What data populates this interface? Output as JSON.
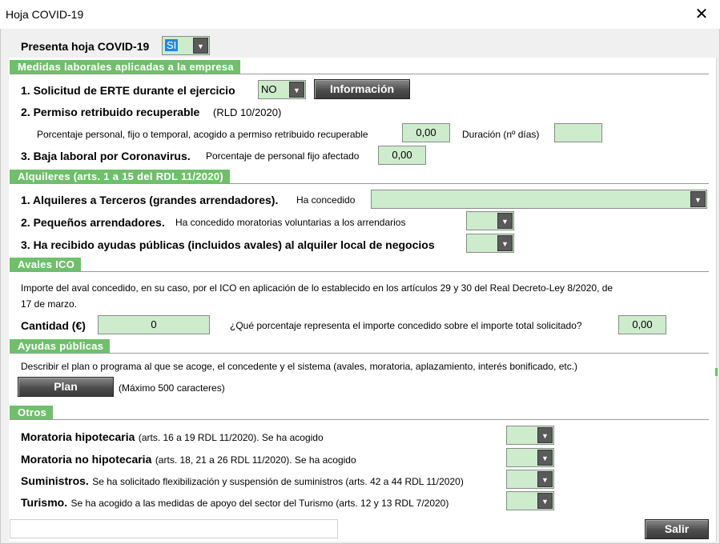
{
  "window": {
    "title": "Hoja COVID-19",
    "close_glyph": "✕"
  },
  "presenta": {
    "label": "Presenta hoja COVID-19",
    "value": "SI"
  },
  "medidas": {
    "header": "Medidas laborales aplicadas a la empresa",
    "erte_label": "1. Solicitud de ERTE durante el ejercicio",
    "erte_value": "NO",
    "info_button": "Información",
    "permiso_label": "2. Permiso retribuido recuperable",
    "permiso_ref": "(RLD 10/2020)",
    "porcentaje_label": "Porcentaje personal, fijo o temporal, acogido a permiso retribuido recuperable",
    "porcentaje_value": "0,00",
    "duracion_label": "Duración (nº días)",
    "duracion_value": "",
    "baja_label": "3. Baja laboral por Coronavirus.",
    "baja_sub": "Porcentaje de personal fijo afectado",
    "baja_value": "0,00"
  },
  "alquileres": {
    "header": "Alquileres (arts. 1 a 15 del RDL 11/2020)",
    "terceros_label": "1. Alquileres a Terceros (grandes arrendadores).",
    "terceros_sub": "Ha concedido",
    "terceros_value": "",
    "pequenos_label": "2. Pequeños arrendadores.",
    "pequenos_sub": "Ha concedido moratorias voluntarias a los arrendarios",
    "pequenos_value": "",
    "ayudas_label": "3. Ha recibido ayudas públicas (incluidos avales) al alquiler local de negocios",
    "ayudas_value": ""
  },
  "avales": {
    "header": "Avales ICO",
    "desc_line1": "Importe del aval concedido, en su caso, por el ICO en aplicación de lo establecido en los artículos 29 y 30 del Real Decreto-Ley 8/2020, de",
    "desc_line2": "17 de marzo.",
    "cantidad_label": "Cantidad (€)",
    "cantidad_value": "0",
    "porcentaje_label": "¿Qué porcentaje representa el importe concedido sobre el importe total solicitado?",
    "porcentaje_value": "0,00"
  },
  "ayudas_publicas": {
    "header": "Ayudas públicas",
    "desc": "Describir el plan o programa al que se acoge, el concedente y el sistema (avales, moratoria, aplazamiento, interés bonificado, etc.)",
    "plan_button": "Plan",
    "max_note": "(Máximo 500 caracteres)"
  },
  "otros": {
    "header": "Otros",
    "items": [
      {
        "title": "Moratoria hipotecaria",
        "desc": "(arts. 16 a 19 RDL 11/2020). Se ha acogido",
        "value": ""
      },
      {
        "title": "Moratoria no hipotecaria",
        "desc": "(arts. 18, 21 a 26 RDL 11/2020). Se ha acogido",
        "value": ""
      },
      {
        "title": "Suministros.",
        "desc": "Se ha solicitado flexibilización y suspensión de suministros (arts. 42 a 44 RDL 11/2020)",
        "value": ""
      },
      {
        "title": "Turismo.",
        "desc": "Se ha acogido a las medidas de apoyo del sector del Turismo (arts. 12 y 13 RDL 7/2020)",
        "value": ""
      }
    ]
  },
  "footer": {
    "status_text": "",
    "salir_button": "Salir"
  },
  "icons": {
    "dropdown": "▼"
  },
  "colors": {
    "section_green": "#6fbf6b",
    "field_green": "#cdeccc",
    "button_dark": "#4e4e4e",
    "selected_blue": "#1e88e5"
  }
}
